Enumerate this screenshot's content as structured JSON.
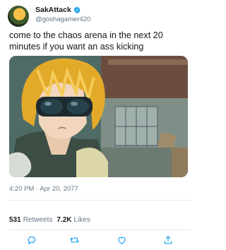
{
  "user": {
    "display_name": "SakAttack",
    "handle": "@goshagamer420",
    "verified": true
  },
  "tweet": {
    "text": "come to the chaos arena in the next 20 minutes if you want an ass kicking",
    "timestamp": "4:20 PM · Apr 20, 2077"
  },
  "stats": {
    "retweets_count": "531",
    "retweets_label": "Retweets",
    "likes_count": "7.2K",
    "likes_label": "Likes"
  },
  "actions": [
    "reply-icon",
    "retweet-icon",
    "like-icon",
    "share-icon"
  ],
  "colors": {
    "verified": "#1da1f2",
    "muted": "#657786",
    "text": "#14171a",
    "icon": "#1da1f2"
  }
}
